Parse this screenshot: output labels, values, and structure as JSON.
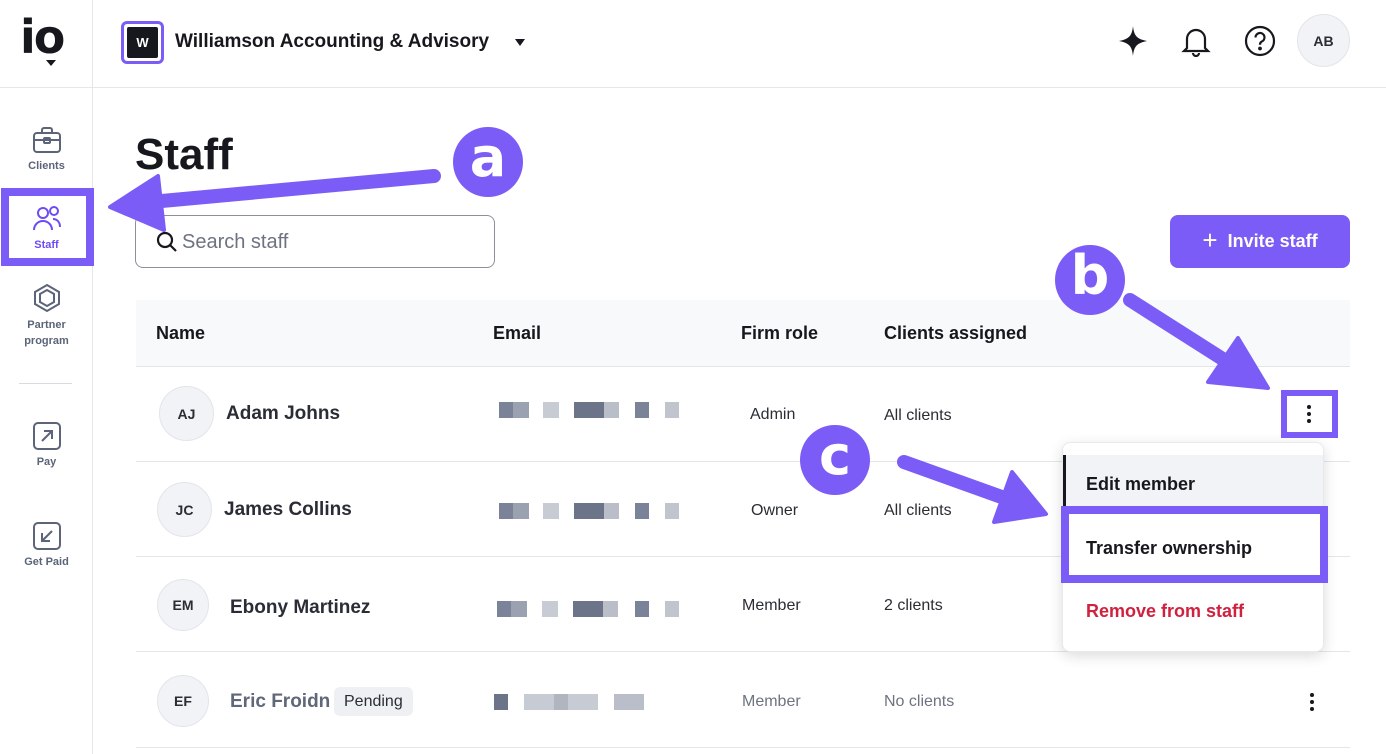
{
  "app": {
    "logo_text": "io"
  },
  "sidebar": {
    "items": [
      {
        "label": "Clients",
        "icon": "briefcase-icon"
      },
      {
        "label": "Staff",
        "icon": "users-icon",
        "active": true
      },
      {
        "label_line1": "Partner",
        "label_line2": "program",
        "icon": "hexagon-gem-icon"
      },
      {
        "label": "Pay",
        "icon": "arrow-up-right-icon"
      },
      {
        "label": "Get Paid",
        "icon": "arrow-down-left-icon"
      }
    ]
  },
  "topbar": {
    "firm_initial": "W",
    "firm_name": "Williamson Accounting & Advisory",
    "icons": [
      "sparkle-icon",
      "bell-icon",
      "help-icon"
    ],
    "user_initials": "AB"
  },
  "page": {
    "title": "Staff",
    "search_placeholder": "Search staff",
    "invite_label": "Invite staff"
  },
  "table": {
    "headers": {
      "name": "Name",
      "email": "Email",
      "role": "Firm role",
      "clients": "Clients assigned"
    },
    "rows": [
      {
        "initials": "AJ",
        "name": "Adam Johns",
        "role": "Admin",
        "clients": "All clients",
        "pending": false
      },
      {
        "initials": "JC",
        "name": "James Collins",
        "role": "Owner",
        "clients": "All clients",
        "pending": false
      },
      {
        "initials": "EM",
        "name": "Ebony Martinez",
        "role": "Member",
        "clients": "2 clients",
        "pending": false
      },
      {
        "initials": "EF",
        "name": "Eric Froidn",
        "role": "Member",
        "clients": "No clients",
        "pending": true,
        "status": "Pending"
      }
    ]
  },
  "menu": {
    "items": [
      "Edit member",
      "Transfer ownership",
      "Remove from staff"
    ]
  },
  "annotations": {
    "letters": [
      "a",
      "b",
      "c"
    ],
    "color": "#7c5cf6"
  },
  "colors": {
    "accent": "#7c5cf6",
    "danger": "#d0213f",
    "text": "#16181d"
  }
}
